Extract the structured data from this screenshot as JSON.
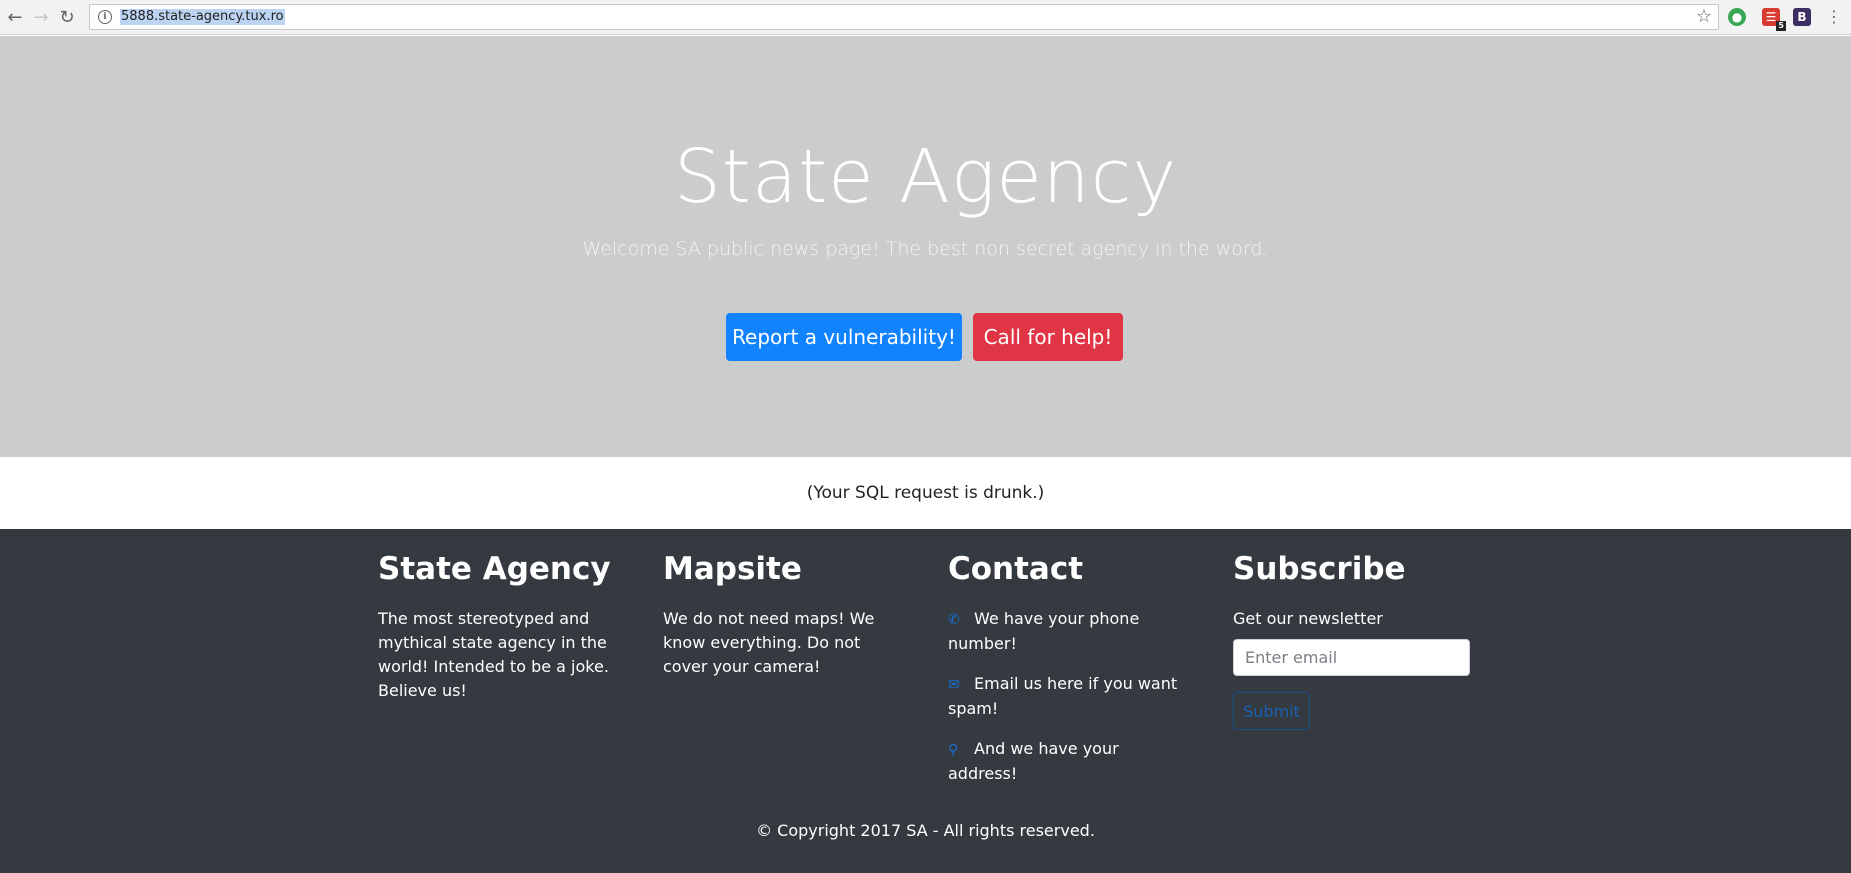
{
  "browser": {
    "url": "5888.state-agency.tux.ro",
    "ext_badge": "5",
    "ext_b": "B"
  },
  "hero": {
    "title": "State Agency",
    "subtitle": "Welcome SA public news page! The best non secret agency in the word.",
    "report_button": "Report a vulnerability!",
    "help_button": "Call for help!"
  },
  "message": "(Your SQL request is drunk.)",
  "footer": {
    "about": {
      "heading": "State Agency",
      "text": "The most stereotyped and mythical state agency in the world! Intended to be a joke. Believe us!"
    },
    "mapsite": {
      "heading": "Mapsite",
      "text": "We do not need maps! We know everything. Do not cover your camera!"
    },
    "contact": {
      "heading": "Contact",
      "phone": "We have your phone number!",
      "email": "Email us here if you want spam!",
      "address": "And we have your address!"
    },
    "subscribe": {
      "heading": "Subscribe",
      "text": "Get our newsletter",
      "placeholder": "Enter email",
      "submit": "Submit"
    },
    "copyright": "© Copyright 2017 SA - All rights reserved."
  },
  "colors": {
    "hero_bg": "#cbccce",
    "primary": "#1283ff",
    "danger": "#df3545",
    "footer_bg": "#343a40"
  }
}
